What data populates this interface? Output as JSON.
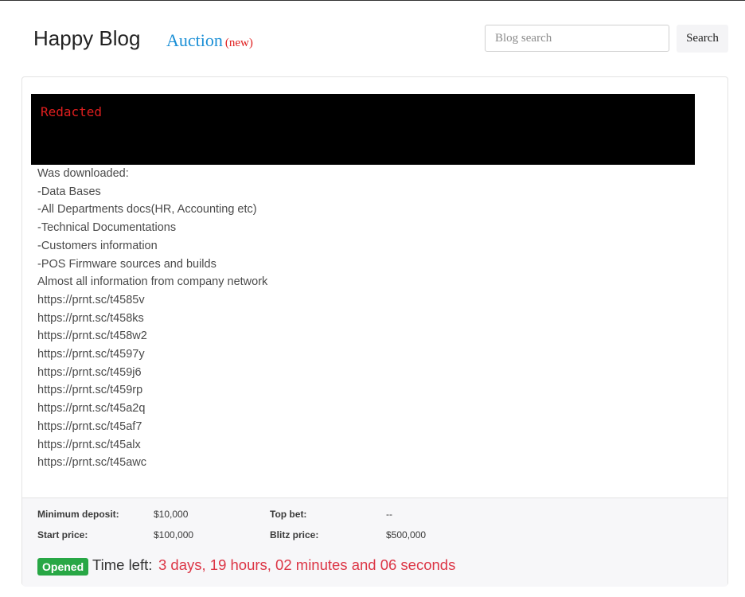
{
  "header": {
    "brand": "Happy Blog",
    "auction_label": "Auction",
    "auction_badge": "(new)",
    "search_placeholder": "Blog search",
    "search_button": "Search"
  },
  "post": {
    "banner_text": "Redacted",
    "lines": [
      "Was downloaded:",
      "-Data Bases",
      "-All Departments docs(HR, Accounting etc)",
      "-Technical Documentations",
      "-Customers information",
      "-POS Firmware sources and builds",
      "Almost all information from company network",
      "https://prnt.sc/t4585v",
      "https://prnt.sc/t458ks",
      "https://prnt.sc/t458w2",
      "https://prnt.sc/t4597y",
      "https://prnt.sc/t459j6",
      "https://prnt.sc/t459rp",
      "https://prnt.sc/t45a2q",
      "https://prnt.sc/t45af7",
      "https://prnt.sc/t45alx",
      "https://prnt.sc/t45awc"
    ]
  },
  "auction": {
    "min_deposit_label": "Minimum deposit:",
    "min_deposit_value": "$10,000",
    "top_bet_label": "Top bet:",
    "top_bet_value": "--",
    "start_price_label": "Start price:",
    "start_price_value": "$100,000",
    "blitz_price_label": "Blitz price:",
    "blitz_price_value": "$500,000",
    "status": "Opened",
    "time_left_label": "Time left:",
    "time_left_value": "3 days, 19 hours, 02 minutes and 06 seconds"
  },
  "colors": {
    "accent_link": "#1a8fd6",
    "new_badge": "#e02020",
    "status_open": "#28a745",
    "countdown": "#dc3545",
    "banner_bg": "#000000",
    "banner_text": "#e01e1e"
  }
}
